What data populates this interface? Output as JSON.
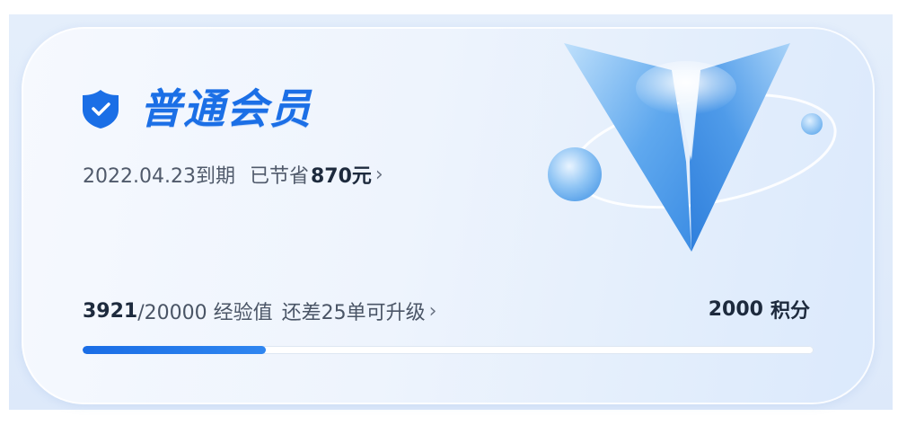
{
  "membership": {
    "level_title": "普通会员",
    "expire_text": "2022.04.23到期",
    "saved_prefix": "已节省",
    "saved_amount": "870元",
    "chevron": "›",
    "badge_icon": "shield-check-icon"
  },
  "experience": {
    "current": "3921",
    "total_text": "/20000 经验值",
    "remaining_text": "还差25单可升级",
    "progress": 0.25
  },
  "points": {
    "value": "2000",
    "label": "积分"
  },
  "colors": {
    "accent": "#1b6fe6",
    "card_bg": "#eef4fd",
    "text_dark": "#1d2a3d"
  }
}
